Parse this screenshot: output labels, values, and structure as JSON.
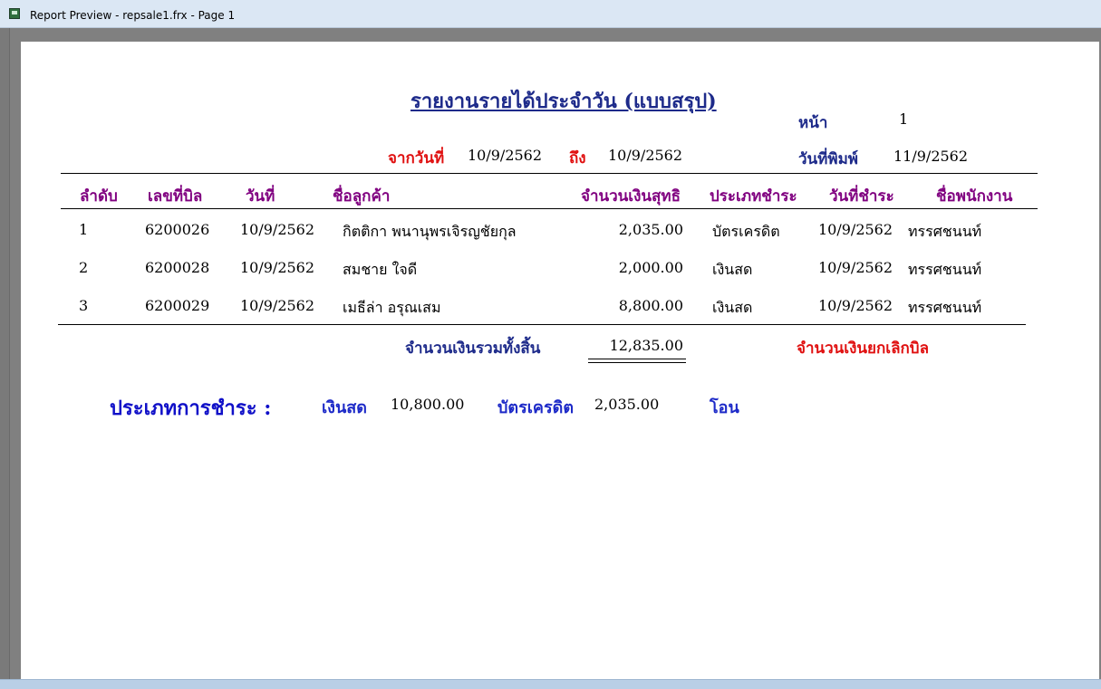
{
  "window": {
    "title": "Report Preview - repsale1.frx - Page 1"
  },
  "report": {
    "title": "รายงานรายได้ประจำวัน (แบบสรุป)",
    "page_label": "หน้า",
    "page_value": "1",
    "from_label": "จากวันที่",
    "from_value": "10/9/2562",
    "to_label": "ถึง",
    "to_value": "10/9/2562",
    "print_date_label": "วันที่พิมพ์",
    "print_date_value": "11/9/2562"
  },
  "table": {
    "headers": [
      "ลำดับ",
      "เลขที่บิล",
      "วันที่",
      "ชื่อลูกค้า",
      "จำนวนเงินสุทธิ",
      "ประเภทชำระ",
      "วันที่ชำระ",
      "ชื่อพนักงาน"
    ],
    "rows": [
      [
        "1",
        "6200026",
        "10/9/2562",
        "กิตติกา พนานุพรเจิรญชัยกุล",
        "2,035.00",
        "บัตรเครดิต",
        "10/9/2562",
        "ทรรศชนนท์"
      ],
      [
        "2",
        "6200028",
        "10/9/2562",
        "สมชาย ใจดี",
        "2,000.00",
        "เงินสด",
        "10/9/2562",
        "ทรรศชนนท์"
      ],
      [
        "3",
        "6200029",
        "10/9/2562",
        "เมธีล่า อรุณเสม",
        "8,800.00",
        "เงินสด",
        "10/9/2562",
        "ทรรศชนนท์"
      ]
    ]
  },
  "totals": {
    "total_label": "จำนวนเงินรวมทั้งสิ้น",
    "total_value": "12,835.00",
    "cancel_label": "จำนวนเงินยกเลิกบิล"
  },
  "payment_summary": {
    "label": "ประเภทการชำระ :",
    "cash_label": "เงินสด",
    "cash_value": "10,800.00",
    "credit_label": "บัตรเครดิต",
    "credit_value": "2,035.00",
    "transfer_label": "โอน"
  }
}
